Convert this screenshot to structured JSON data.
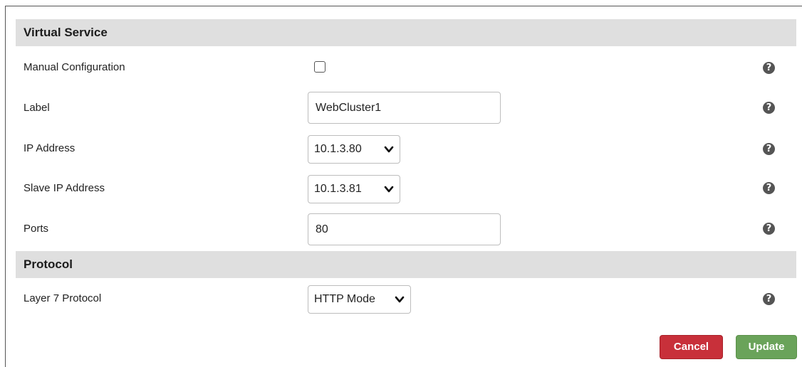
{
  "sections": {
    "virtual_service": "Virtual Service",
    "protocol": "Protocol"
  },
  "fields": {
    "manual_configuration": {
      "label": "Manual Configuration",
      "checked": false
    },
    "label": {
      "label": "Label",
      "value": "WebCluster1"
    },
    "ip_address": {
      "label": "IP Address",
      "value": "10.1.3.80"
    },
    "slave_ip_address": {
      "label": "Slave IP Address",
      "value": "10.1.3.81"
    },
    "ports": {
      "label": "Ports",
      "value": "80"
    },
    "layer7_protocol": {
      "label": "Layer 7 Protocol",
      "value": "HTTP Mode"
    }
  },
  "help_glyph": "?",
  "buttons": {
    "cancel": "Cancel",
    "update": "Update"
  },
  "colors": {
    "header_bg": "#dfdfdf",
    "cancel": "#c8303a",
    "update": "#6aa35a",
    "help": "#555555"
  }
}
